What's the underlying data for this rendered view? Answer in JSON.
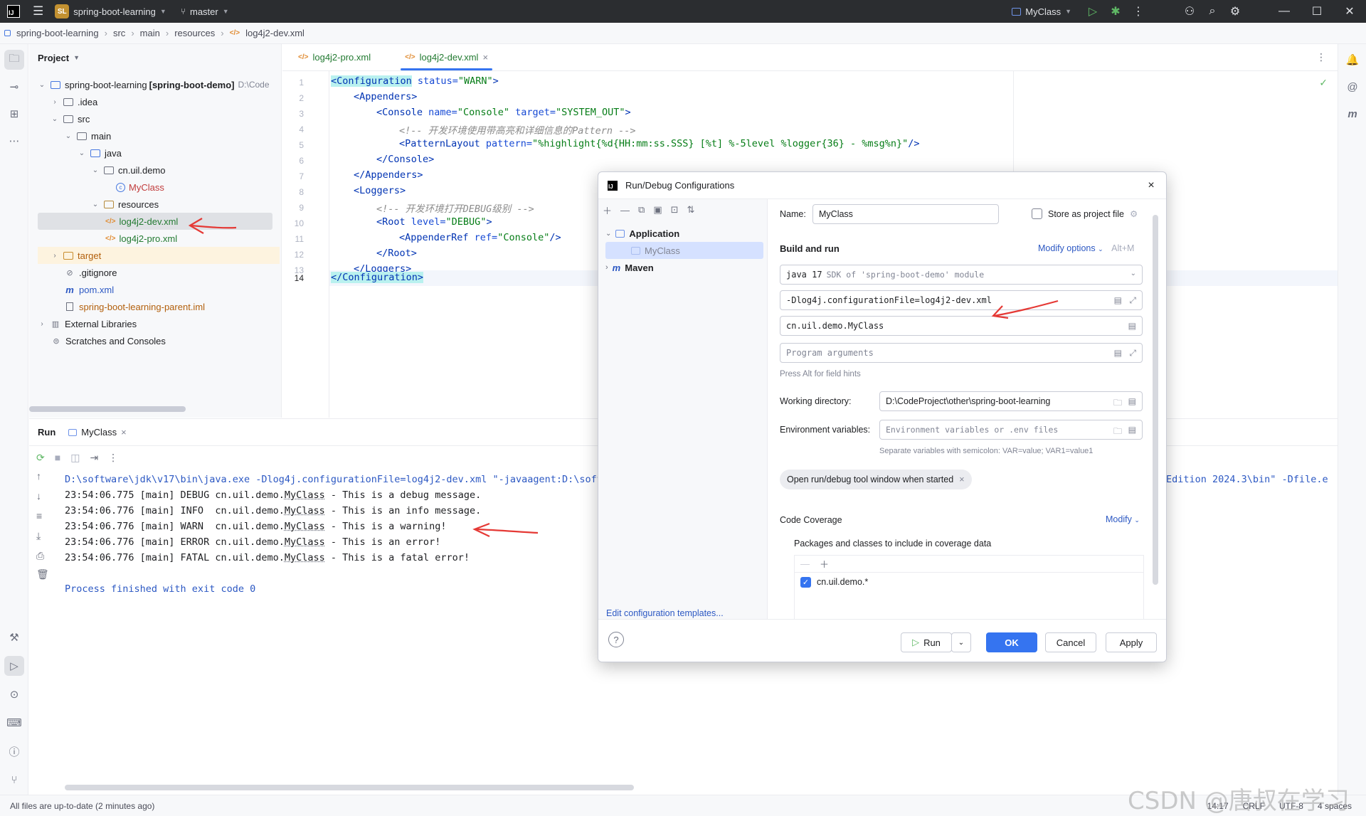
{
  "titlebar": {
    "project_badge": "SL",
    "project_name": "spring-boot-learning",
    "branch": "master",
    "run_config": "MyClass"
  },
  "breadcrumb": [
    "spring-boot-learning",
    "src",
    "main",
    "resources",
    "log4j2-dev.xml"
  ],
  "project_panel": {
    "title": "Project",
    "tree": [
      {
        "label": "spring-boot-learning",
        "bold_suffix": "[spring-boot-demo]",
        "path": "D:\\Code"
      },
      {
        "label": ".idea"
      },
      {
        "label": "src"
      },
      {
        "label": "main"
      },
      {
        "label": "java"
      },
      {
        "label": "cn.uil.demo"
      },
      {
        "label": "MyClass"
      },
      {
        "label": "resources"
      },
      {
        "label": "log4j2-dev.xml"
      },
      {
        "label": "log4j2-pro.xml"
      },
      {
        "label": "target"
      },
      {
        "label": ".gitignore"
      },
      {
        "label": "pom.xml"
      },
      {
        "label": "spring-boot-learning-parent.iml"
      },
      {
        "label": "External Libraries"
      },
      {
        "label": "Scratches and Consoles"
      }
    ]
  },
  "editor": {
    "tabs": [
      {
        "label": "log4j2-pro.xml"
      },
      {
        "label": "log4j2-dev.xml",
        "close": "×"
      }
    ],
    "line_numbers": [
      "1",
      "2",
      "3",
      "4",
      "5",
      "6",
      "7",
      "8",
      "9",
      "10",
      "11",
      "12",
      "13",
      "14"
    ],
    "code": {
      "l1_tag": "<Configuration",
      "l1_attr": " status=",
      "l1_val": "\"WARN\"",
      "l1_end": ">",
      "l2": "<Appenders>",
      "l3_tag": "<Console",
      "l3_attr1": " name=",
      "l3_val1": "\"Console\"",
      "l3_attr2": " target=",
      "l3_val2": "\"SYSTEM_OUT\"",
      "l3_end": ">",
      "l4": "<!-- 开发环境使用带高亮和详细信息的Pattern -->",
      "l5_tag": "<PatternLayout",
      "l5_attr": " pattern=",
      "l5_val": "\"%highlight{%d{HH:mm:ss.SSS} [%t] %-5level %logger{36} - %msg%n}\"",
      "l5_end": "/>",
      "l6": "</Console>",
      "l7": "</Appenders>",
      "l8": "<Loggers>",
      "l9": "<!-- 开发环境打开DEBUG级别 -->",
      "l10_tag": "<Root",
      "l10_attr": " level=",
      "l10_val": "\"DEBUG\"",
      "l10_end": ">",
      "l11_tag": "<AppenderRef",
      "l11_attr": " ref=",
      "l11_val": "\"Console\"",
      "l11_end": "/>",
      "l12": "</Root>",
      "l13": "</Loggers>",
      "l14": "</Configuration>"
    }
  },
  "run_panel": {
    "tab_run": "Run",
    "tab_config": "MyClass",
    "tab_close": "×",
    "command_line": "D:\\software\\jdk\\v17\\bin\\java.exe -Dlog4j.configurationFile=log4j2-dev.xml \"-javaagent:D:\\soft",
    "command_tail": "Edition 2024.3\\bin\" -Dfile.e",
    "logs": [
      {
        "prefix": "23:54:06.775 [main] DEBUG cn.uil.demo.",
        "cls": "MyClass",
        "msg": " - This is a debug message."
      },
      {
        "prefix": "23:54:06.776 [main] INFO  cn.uil.demo.",
        "cls": "MyClass",
        "msg": " - This is an info message."
      },
      {
        "prefix": "23:54:06.776 [main] WARN  cn.uil.demo.",
        "cls": "MyClass",
        "msg": " - This is a warning!"
      },
      {
        "prefix": "23:54:06.776 [main] ERROR cn.uil.demo.",
        "cls": "MyClass",
        "msg": " - This is an error!"
      },
      {
        "prefix": "23:54:06.776 [main] FATAL cn.uil.demo.",
        "cls": "MyClass",
        "msg": " - This is a fatal error!"
      }
    ],
    "exit_message": "Process finished with exit code 0"
  },
  "statusbar": {
    "message": "All files are up-to-date (2 minutes ago)",
    "position": "14:17",
    "line_sep": "CRLF",
    "encoding": "UTF-8",
    "indent": "4 spaces"
  },
  "dialog": {
    "title": "Run/Debug Configurations",
    "close": "×",
    "tree": {
      "application": "Application",
      "config": "MyClass",
      "maven": "Maven"
    },
    "edit_templates": "Edit configuration templates...",
    "name_label": "Name:",
    "name_value": "MyClass",
    "store_label": "Store as project file",
    "build_run_title": "Build and run",
    "modify_options": "Modify options",
    "modify_shortcut": "Alt+M",
    "sdk_java": "java 17",
    "sdk_desc": "SDK of 'spring-boot-demo' module",
    "vm_options": "-Dlog4j.configurationFile=log4j2-dev.xml",
    "main_class": "cn.uil.demo.MyClass",
    "program_args_placeholder": "Program arguments",
    "field_hint": "Press Alt for field hints",
    "workdir_label": "Working directory:",
    "workdir_value": "D:\\CodeProject\\other\\spring-boot-learning",
    "env_label": "Environment variables:",
    "env_placeholder": "Environment variables or .env files",
    "env_hint": "Separate variables with semicolon: VAR=value; VAR1=value1",
    "chip_label": "Open run/debug tool window when started",
    "chip_close": "×",
    "coverage_title": "Code Coverage",
    "coverage_modify": "Modify",
    "coverage_packages": "Packages and classes to include in coverage data",
    "coverage_item": "cn.uil.demo.*",
    "btn_run": "Run",
    "btn_ok": "OK",
    "btn_cancel": "Cancel",
    "btn_apply": "Apply",
    "help": "?"
  },
  "watermark": "CSDN @唐叔在学习",
  "colors": {
    "accent": "#3574f0",
    "titlebar": "#2b2d30",
    "arrow": "#e53935"
  }
}
